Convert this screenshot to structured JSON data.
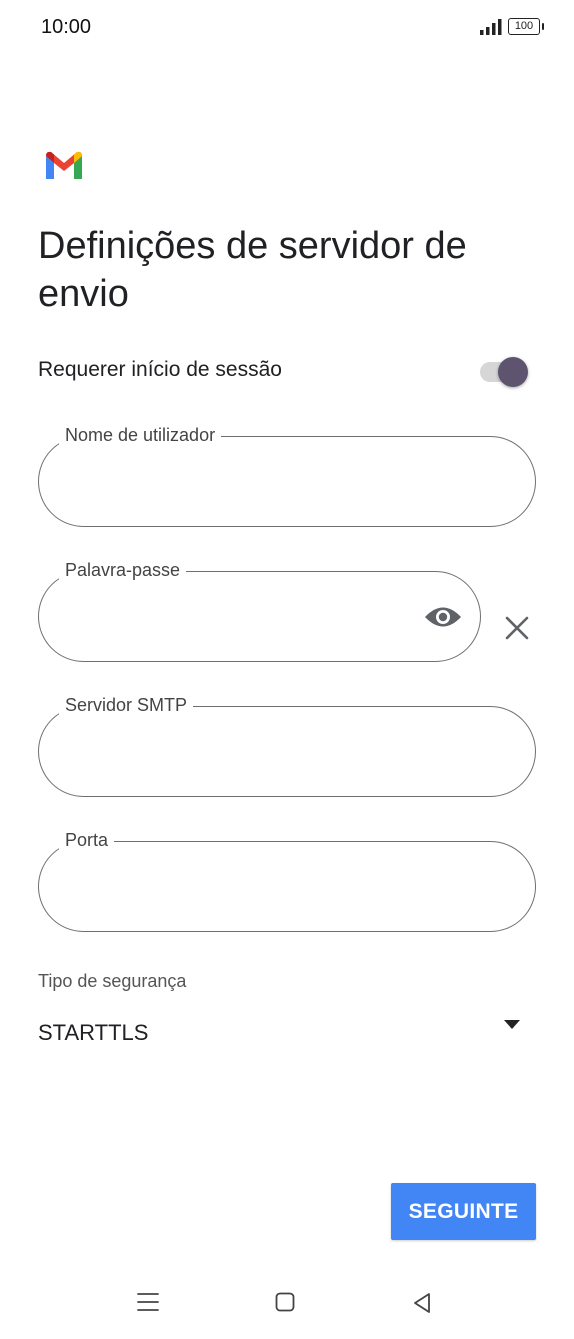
{
  "status_bar": {
    "time": "10:00",
    "battery": "100"
  },
  "header": {
    "logo_icon": "gmail-logo-icon",
    "title": "Definições de servidor de envio"
  },
  "login_toggle": {
    "label": "Requerer início de sessão",
    "on": true
  },
  "fields": {
    "username": {
      "label": "Nome de utilizador",
      "value": ""
    },
    "password": {
      "label": "Palavra-passe",
      "value": ""
    },
    "smtp_server": {
      "label": "Servidor SMTP",
      "value": ""
    },
    "port": {
      "label": "Porta",
      "value": ""
    }
  },
  "security": {
    "label": "Tipo de segurança",
    "selected": "STARTTLS"
  },
  "actions": {
    "next_label": "SEGUINTE"
  },
  "colors": {
    "primary": "#4285f4",
    "toggle_thumb": "#5e5470"
  }
}
